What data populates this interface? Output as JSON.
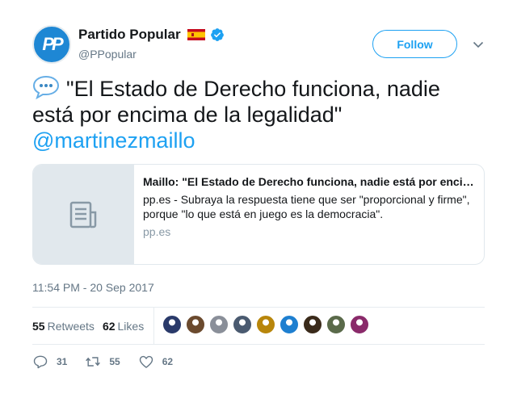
{
  "author": {
    "avatar_text": "PP",
    "display_name": "Partido Popular",
    "handle": "@PPopular",
    "verified": true
  },
  "follow_label": "Follow",
  "tweet": {
    "text": "\"El Estado de Derecho funciona, nadie está por encima de la legalidad\"",
    "mention": "@martinezmaillo"
  },
  "card": {
    "title": "Maillo: \"El Estado de Derecho funciona, nadie está por encima de la legalidad\"",
    "description": "pp.es - Subraya la respuesta tiene que ser \"proporcional y firme\", porque \"lo que está en juego es la democracia\".",
    "domain": "pp.es"
  },
  "timestamp": "11:54 PM - 20 Sep 2017",
  "stats": {
    "retweets_count": "55",
    "retweets_label": "Retweets",
    "likes_count": "62",
    "likes_label": "Likes"
  },
  "actions": {
    "replies": "31",
    "retweets": "55",
    "likes": "62"
  },
  "likers_colors": [
    "#2a3a6a",
    "#6b4a2e",
    "#8a8f99",
    "#4a5a70",
    "#b8860b",
    "#1e7fd0",
    "#3a2a1a",
    "#5a6a4a",
    "#8a2a6a"
  ],
  "colors": {
    "accent": "#1da1f2",
    "secondary_text": "#657786"
  }
}
